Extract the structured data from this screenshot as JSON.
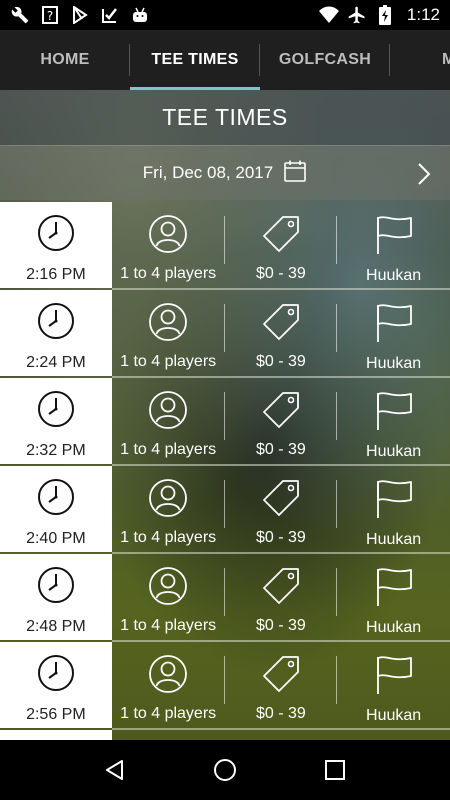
{
  "status_bar": {
    "left_icons": [
      "wrench-icon",
      "help-icon",
      "play-store-icon",
      "check-icon",
      "android-icon"
    ],
    "right_icons": [
      "wifi-icon",
      "airplane-mode-icon",
      "battery-icon"
    ],
    "time": "1:12"
  },
  "tabs": [
    {
      "label": "HOME",
      "active": false
    },
    {
      "label": "TEE TIMES",
      "active": true
    },
    {
      "label": "GOLFCASH",
      "active": false
    },
    {
      "label": "M",
      "active": false
    }
  ],
  "accent_color": "#7fc4c9",
  "page_title": "TEE TIMES",
  "date": "Fri, Dec 08, 2017",
  "tee_times": [
    {
      "time": "2:16 PM",
      "players": "1 to 4 players",
      "price": "$0 - 39",
      "course": "Huukan"
    },
    {
      "time": "2:24 PM",
      "players": "1 to 4 players",
      "price": "$0 - 39",
      "course": "Huukan"
    },
    {
      "time": "2:32 PM",
      "players": "1 to 4 players",
      "price": "$0 - 39",
      "course": "Huukan"
    },
    {
      "time": "2:40 PM",
      "players": "1 to 4 players",
      "price": "$0 - 39",
      "course": "Huukan"
    },
    {
      "time": "2:48 PM",
      "players": "1 to 4 players",
      "price": "$0 - 39",
      "course": "Huukan"
    },
    {
      "time": "2:56 PM",
      "players": "1 to 4 players",
      "price": "$0 - 39",
      "course": "Huukan"
    }
  ],
  "nav_bar": [
    "back-icon",
    "home-icon",
    "recents-icon"
  ]
}
